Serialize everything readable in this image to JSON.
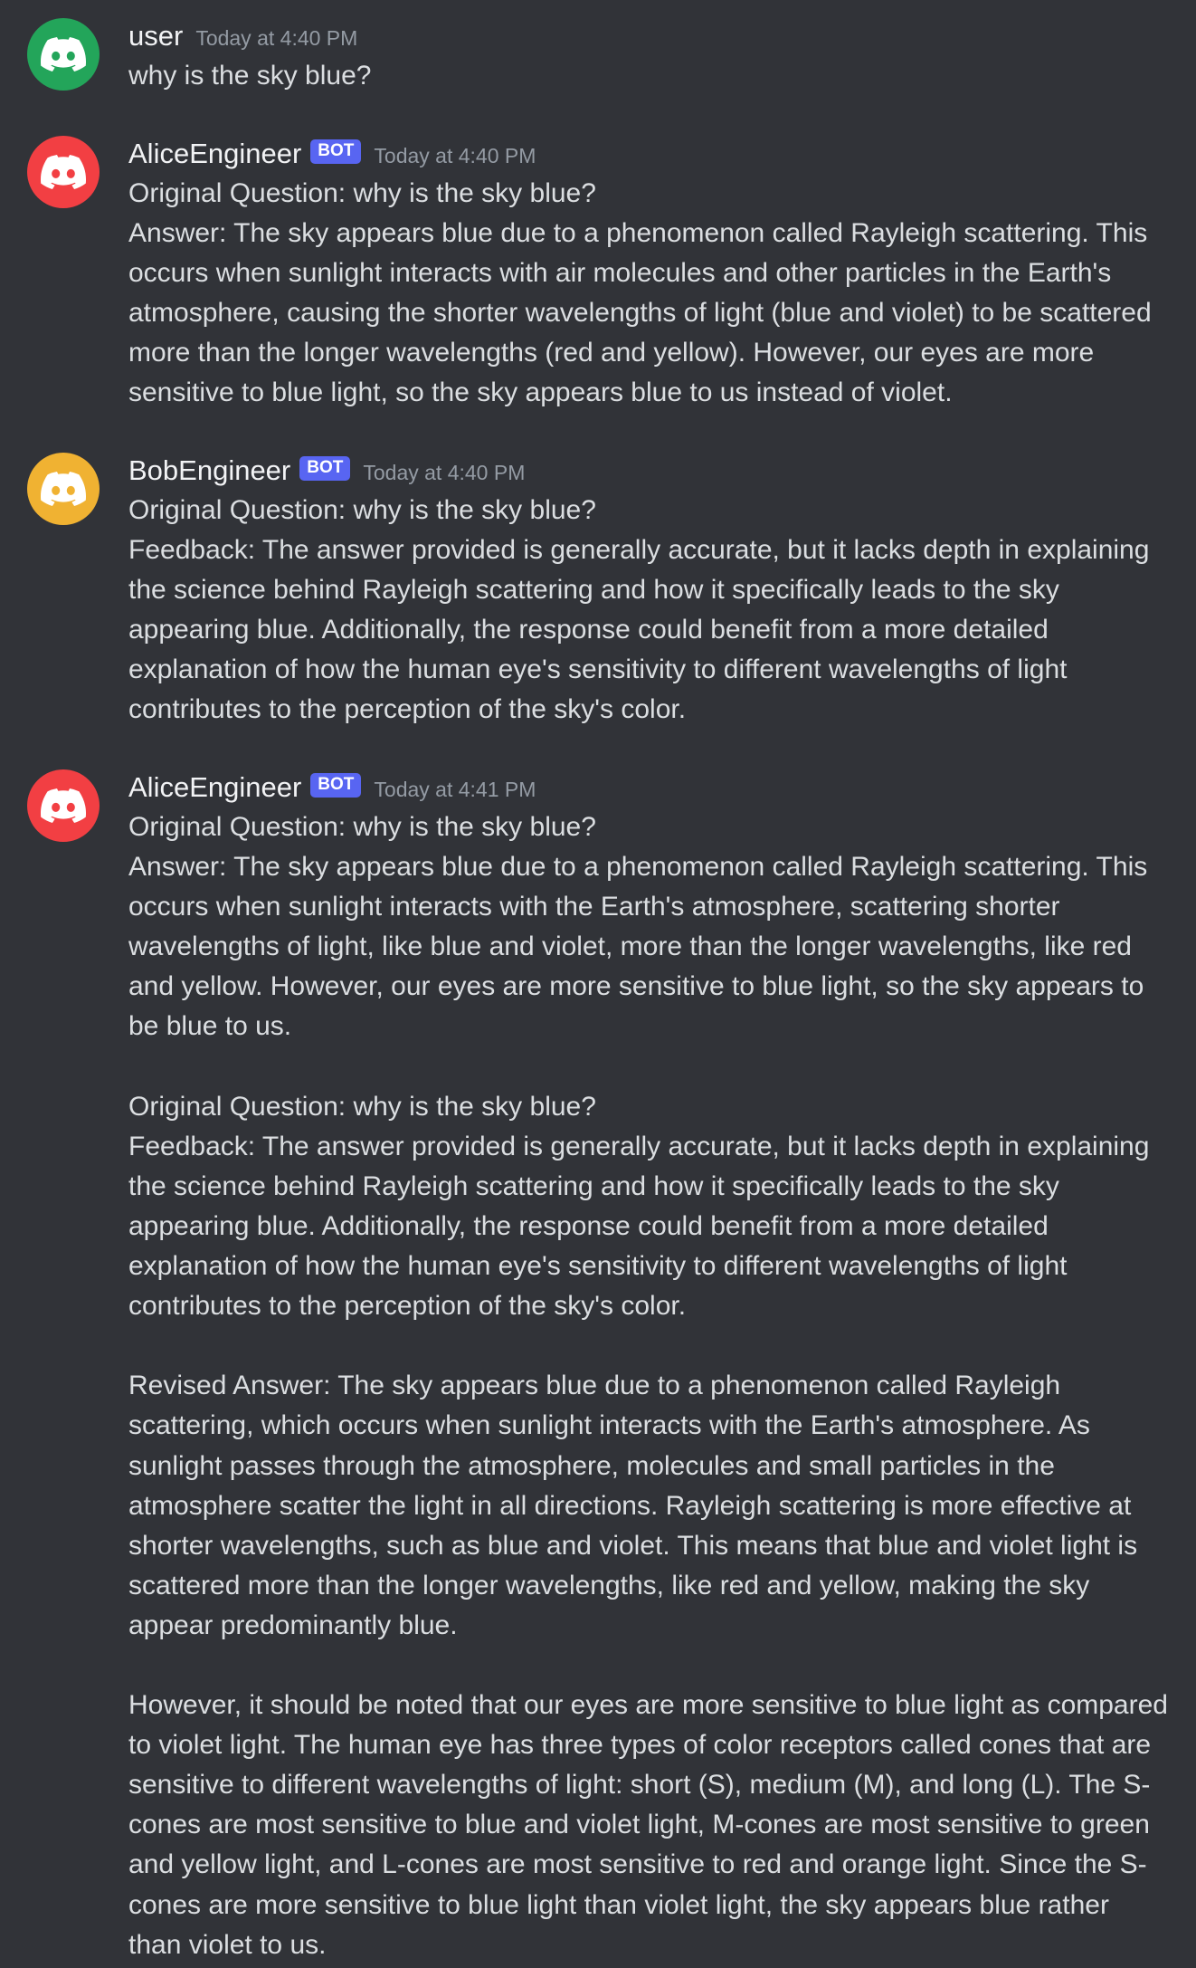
{
  "colors": {
    "background": "#313338",
    "bot_tag": "#5865f2",
    "avatar_green": "#23a55a",
    "avatar_red": "#f23f43",
    "avatar_orange": "#f0b232"
  },
  "messages": [
    {
      "username": "user",
      "avatar_icon": "discord-logo-icon",
      "avatar_color": "green",
      "bot": false,
      "timestamp": "Today at 4:40 PM",
      "paragraphs": [
        "why is the sky blue?"
      ]
    },
    {
      "username": "AliceEngineer",
      "avatar_icon": "discord-logo-icon",
      "avatar_color": "red",
      "bot": true,
      "bot_label": "BOT",
      "timestamp": "Today at 4:40 PM",
      "paragraphs": [
        "Original Question: why is the sky blue?\nAnswer: The sky appears blue due to a phenomenon called Rayleigh scattering. This occurs when sunlight interacts with air molecules and other particles in the Earth's atmosphere, causing the shorter wavelengths of light (blue and violet) to be scattered more than the longer wavelengths (red and yellow). However, our eyes are more sensitive to blue light, so the sky appears blue to us instead of violet."
      ]
    },
    {
      "username": "BobEngineer",
      "avatar_icon": "discord-logo-icon",
      "avatar_color": "orange",
      "bot": true,
      "bot_label": "BOT",
      "timestamp": "Today at 4:40 PM",
      "paragraphs": [
        "Original Question: why is the sky blue?\nFeedback: The answer provided is generally accurate, but it lacks depth in explaining the science behind Rayleigh scattering and how it specifically leads to the sky appearing blue. Additionally, the response could benefit from a more detailed explanation of how the human eye's sensitivity to different wavelengths of light contributes to the perception of the sky's color."
      ]
    },
    {
      "username": "AliceEngineer",
      "avatar_icon": "discord-logo-icon",
      "avatar_color": "red",
      "bot": true,
      "bot_label": "BOT",
      "timestamp": "Today at 4:41 PM",
      "paragraphs": [
        "Original Question: why is the sky blue?\nAnswer: The sky appears blue due to a phenomenon called Rayleigh scattering. This occurs when sunlight interacts with the Earth's atmosphere, scattering shorter wavelengths of light, like blue and violet, more than the longer wavelengths, like red and yellow. However, our eyes are more sensitive to blue light, so the sky appears to be blue to us.",
        "Original Question: why is the sky blue?\nFeedback: The answer provided is generally accurate, but it lacks depth in explaining the science behind Rayleigh scattering and how it specifically leads to the sky appearing blue. Additionally, the response could benefit from a more detailed explanation of how the human eye's sensitivity to different wavelengths of light contributes to the perception of the sky's color.",
        "Revised Answer: The sky appears blue due to a phenomenon called Rayleigh scattering, which occurs when sunlight interacts with the Earth's atmosphere. As sunlight passes through the atmosphere, molecules and small particles in the atmosphere scatter the light in all directions. Rayleigh scattering is more effective at shorter wavelengths, such as blue and violet. This means that blue and violet light is scattered more than the longer wavelengths, like red and yellow, making the sky appear predominantly blue.",
        "However, it should be noted that our eyes are more sensitive to blue light as compared to violet light. The human eye has three types of color receptors called cones that are sensitive to different wavelengths of light: short (S), medium (M), and long (L). The S-cones are most sensitive to blue and violet light, M-cones are most sensitive to green and yellow light, and L-cones are most sensitive to red and orange light. Since the S-cones are more sensitive to blue light than violet light, the sky appears blue rather than violet to us."
      ]
    }
  ]
}
